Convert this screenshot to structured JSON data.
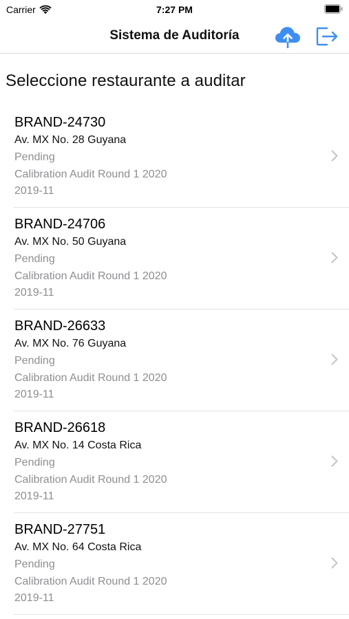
{
  "status_bar": {
    "carrier": "Carrier",
    "time": "7:27 PM"
  },
  "nav": {
    "title": "Sistema de Auditoría",
    "accent_color": "#3d8ef0",
    "upload_icon": "cloud-upload-icon",
    "logout_icon": "logout-icon"
  },
  "section_title": "Seleccione restaurante a auditar",
  "restaurants": [
    {
      "brand": "BRAND-24730",
      "address": "Av. MX No. 28 Guyana",
      "status": "Pending",
      "audit": "Calibration Audit Round 1 2020",
      "period": "2019-11"
    },
    {
      "brand": "BRAND-24706",
      "address": "Av. MX No. 50 Guyana",
      "status": "Pending",
      "audit": "Calibration Audit Round 1 2020",
      "period": "2019-11"
    },
    {
      "brand": "BRAND-26633",
      "address": "Av. MX No. 76 Guyana",
      "status": "Pending",
      "audit": "Calibration Audit Round 1 2020",
      "period": "2019-11"
    },
    {
      "brand": "BRAND-26618",
      "address": "Av. MX No. 14 Costa Rica",
      "status": "Pending",
      "audit": "Calibration Audit Round 1 2020",
      "period": "2019-11"
    },
    {
      "brand": "BRAND-27751",
      "address": "Av. MX No. 64 Costa Rica",
      "status": "Pending",
      "audit": "Calibration Audit Round 1 2020",
      "period": "2019-11"
    }
  ]
}
